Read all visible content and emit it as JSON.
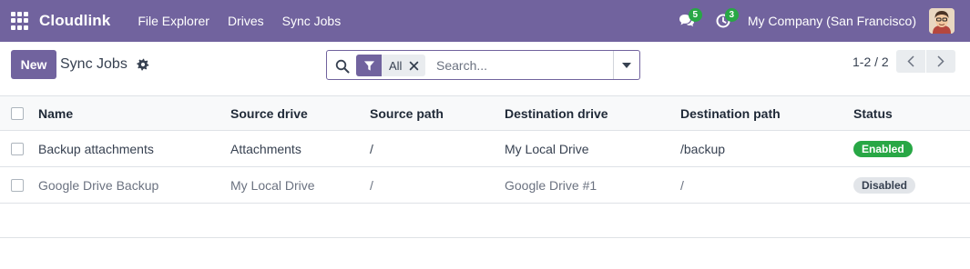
{
  "navbar": {
    "brand": "Cloudlink",
    "menu": [
      "File Explorer",
      "Drives",
      "Sync Jobs"
    ],
    "messages_count": "5",
    "activities_count": "3",
    "company": "My Company (San Francisco)",
    "color": "#71639e"
  },
  "control_panel": {
    "new_label": "New",
    "title": "Sync Jobs",
    "search": {
      "facet_label": "All",
      "placeholder": "Search..."
    },
    "pager": "1-2 / 2"
  },
  "table": {
    "columns": [
      "Name",
      "Source drive",
      "Source path",
      "Destination drive",
      "Destination path",
      "Status"
    ],
    "rows": [
      {
        "name": "Backup attachments",
        "source_drive": "Attachments",
        "source_path": "/",
        "destination_drive": "My Local Drive",
        "destination_path": "/backup",
        "status": "Enabled"
      },
      {
        "name": "Google Drive Backup",
        "source_drive": "My Local Drive",
        "source_path": "/",
        "destination_drive": "Google Drive #1",
        "destination_path": "/",
        "status": "Disabled"
      }
    ]
  },
  "colors": {
    "accent": "#71639e",
    "enabled": "#28a745",
    "disabled": "#e2e5e9"
  }
}
